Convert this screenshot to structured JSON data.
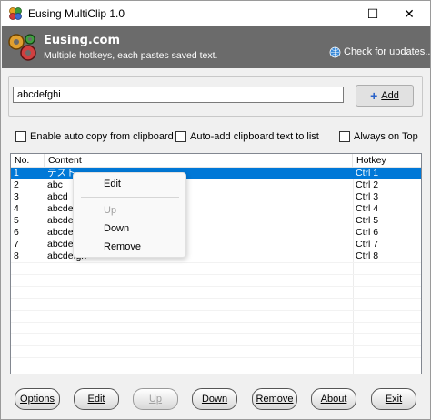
{
  "window": {
    "title": "Eusing MultiClip 1.0",
    "minimize_glyph": "—",
    "maximize_glyph": "☐",
    "close_glyph": "✕"
  },
  "banner": {
    "title": "Eusing.com",
    "subtitle": "Multiple hotkeys, each pastes saved text.",
    "update_link": "Check for updates...",
    "background_color": "#6b6b6b"
  },
  "input": {
    "value": "abcdefghi"
  },
  "add_button": {
    "label": "Add",
    "icon": "plus-icon"
  },
  "checkboxes": [
    {
      "label": "Enable auto copy from clipboard",
      "checked": false
    },
    {
      "label": "Auto-add clipboard text to list",
      "checked": false
    },
    {
      "label": "Always on Top",
      "checked": false
    }
  ],
  "list": {
    "columns": [
      "No.",
      "Content",
      "Hotkey"
    ],
    "rows": [
      {
        "no": "1",
        "content": "テスト",
        "hotkey": "Ctrl 1",
        "selected": true
      },
      {
        "no": "2",
        "content": "abc",
        "hotkey": "Ctrl 2",
        "selected": false
      },
      {
        "no": "3",
        "content": "abcd",
        "hotkey": "Ctrl 3",
        "selected": false
      },
      {
        "no": "4",
        "content": "abcde",
        "hotkey": "Ctrl 4",
        "selected": false
      },
      {
        "no": "5",
        "content": "abcde",
        "hotkey": "Ctrl 5",
        "selected": false
      },
      {
        "no": "6",
        "content": "abcde",
        "hotkey": "Ctrl 6",
        "selected": false
      },
      {
        "no": "7",
        "content": "abcde",
        "hotkey": "Ctrl 7",
        "selected": false
      },
      {
        "no": "8",
        "content": "abcdefgh",
        "hotkey": "Ctrl 8",
        "selected": false
      }
    ],
    "selection_color": "#0078d7"
  },
  "context_menu": {
    "items": [
      {
        "label": "Edit",
        "enabled": true
      },
      {
        "label": "Up",
        "enabled": false
      },
      {
        "label": "Down",
        "enabled": true
      },
      {
        "label": "Remove",
        "enabled": true
      }
    ]
  },
  "buttons": {
    "options": "Options",
    "edit": "Edit",
    "up": "Up",
    "down": "Down",
    "remove": "Remove",
    "about": "About",
    "exit": "Exit"
  }
}
